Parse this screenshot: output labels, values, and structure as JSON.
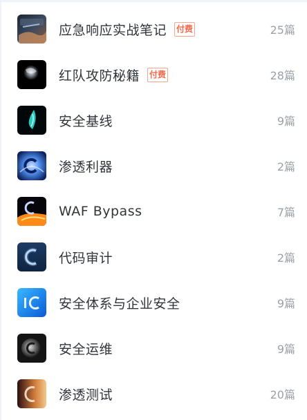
{
  "columns": [
    {
      "title": "应急响应实战笔记",
      "badge": "付费",
      "count": "25篇",
      "thumb_icon": "keyboard-photo-icon",
      "thumb_colors": [
        "#3a4a5e",
        "#8a5a3c",
        "#1b2433"
      ]
    },
    {
      "title": "红队攻防秘籍",
      "badge": "付费",
      "count": "28篇",
      "thumb_icon": "smoke-orb-icon",
      "thumb_colors": [
        "#000000",
        "#a8b4c4",
        "#ffffff"
      ]
    },
    {
      "title": "安全基线",
      "badge": "",
      "count": "9篇",
      "thumb_icon": "cyan-flame-icon",
      "thumb_colors": [
        "#02070a",
        "#2ee0d0",
        "#0a3a3a"
      ]
    },
    {
      "title": "渗透利器",
      "badge": "",
      "count": "2篇",
      "thumb_icon": "blue-swirl-c-icon",
      "thumb_colors": [
        "#0c1f5a",
        "#4f8ff0",
        "#c8dcff"
      ]
    },
    {
      "title": "WAF Bypass",
      "badge": "",
      "count": "7篇",
      "thumb_icon": "fire-c-icon",
      "thumb_colors": [
        "#05050a",
        "#ff8a1a",
        "#ffe07a"
      ]
    },
    {
      "title": "代码审计",
      "badge": "",
      "count": "2篇",
      "thumb_icon": "glow-c-icon",
      "thumb_colors": [
        "#0e2440",
        "#7fb2e8",
        "#dceaff"
      ]
    },
    {
      "title": "安全体系与企业安全",
      "badge": "",
      "count": "9篇",
      "thumb_icon": "blue-ic-icon",
      "thumb_colors": [
        "#0a5ad8",
        "#39b8ff",
        "#e8f6ff"
      ]
    },
    {
      "title": "安全运维",
      "badge": "",
      "count": "9篇",
      "thumb_icon": "metal-c-icon",
      "thumb_colors": [
        "#141414",
        "#6f6f6f",
        "#d8d8d8"
      ]
    },
    {
      "title": "渗透测试",
      "badge": "",
      "count": "20篇",
      "thumb_icon": "sunset-c-icon",
      "thumb_colors": [
        "#2a0f12",
        "#d07a3a",
        "#f5c98a"
      ]
    }
  ]
}
